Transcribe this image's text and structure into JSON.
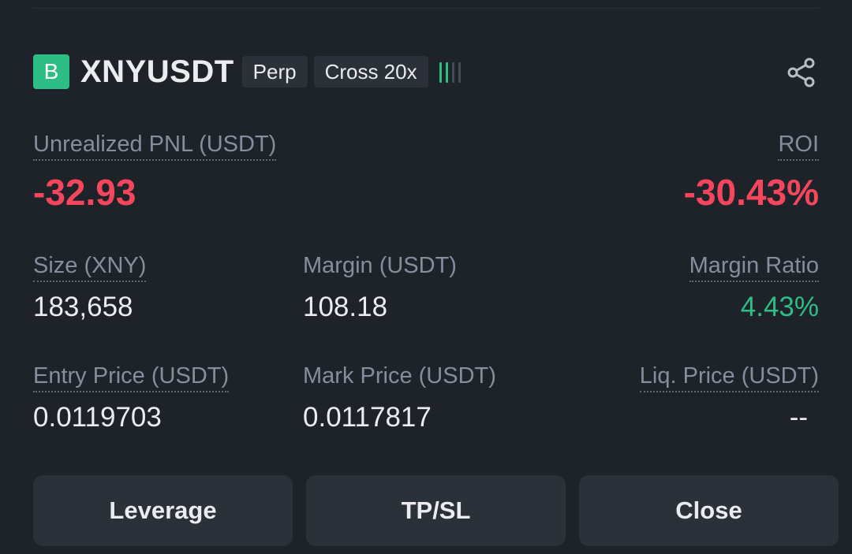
{
  "header": {
    "side_badge": "B",
    "symbol": "XNYUSDT",
    "tags": [
      "Perp",
      "Cross 20x"
    ],
    "risk_level": 2,
    "risk_max": 4,
    "share_icon": "share-icon"
  },
  "pnl": {
    "label": "Unrealized PNL (USDT)",
    "value": "-32.93"
  },
  "roi": {
    "label": "ROI",
    "value": "-30.43%"
  },
  "size": {
    "label": "Size (XNY)",
    "value": "183,658"
  },
  "margin": {
    "label": "Margin (USDT)",
    "value": "108.18"
  },
  "margin_ratio": {
    "label": "Margin Ratio",
    "value": "4.43%"
  },
  "entry_price": {
    "label": "Entry Price (USDT)",
    "value": "0.0119703"
  },
  "mark_price": {
    "label": "Mark Price (USDT)",
    "value": "0.0117817"
  },
  "liq_price": {
    "label": "Liq. Price (USDT)",
    "value": "--"
  },
  "buttons": {
    "leverage": "Leverage",
    "tpsl": "TP/SL",
    "close": "Close"
  },
  "colors": {
    "background": "#1e2329",
    "buy_green": "#2ebd85",
    "sell_red": "#f6465d",
    "label_gray": "#848e9c",
    "button_bg": "#2b3139"
  }
}
